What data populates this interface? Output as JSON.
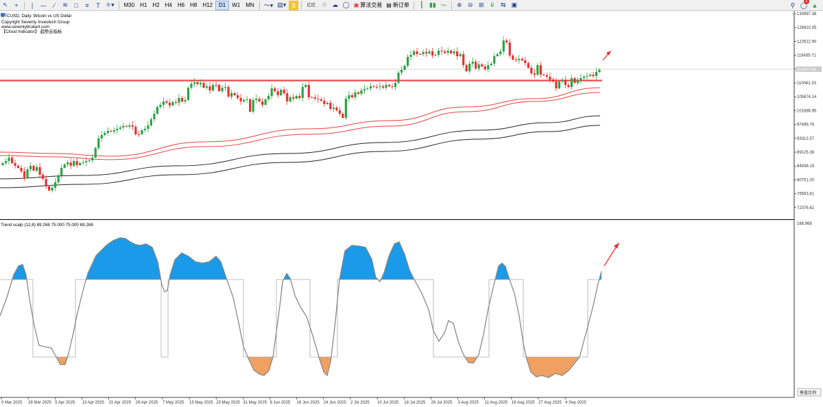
{
  "toolbar": {
    "timeframes": [
      {
        "label": "M30",
        "active": false
      },
      {
        "label": "H1",
        "active": false
      },
      {
        "label": "H2",
        "active": false
      },
      {
        "label": "H4",
        "active": false
      },
      {
        "label": "H6",
        "active": false
      },
      {
        "label": "H8",
        "active": false
      },
      {
        "label": "H12",
        "active": false
      },
      {
        "label": "D1",
        "active": true
      },
      {
        "label": "W1",
        "active": false
      },
      {
        "label": "MN",
        "active": false
      }
    ],
    "algo_trading_label": "算法交易",
    "new_order_label": "新订单",
    "ide_label": "IDE",
    "notifications_count": "1"
  },
  "main_chart": {
    "symbol_line": "BTCUSD, Daily:  Bitcoin vs US Dollar",
    "copyright": "Copyright Seventy Investech Group",
    "website": "www.seventybrokert.com",
    "indicator_name": "【Cloud Indicator】 趋势云指标",
    "price_labels": [
      "130997.38",
      "126810.05",
      "122622.90",
      "118435.71",
      "114248.52",
      "110061.33",
      "105874.14",
      "101686.95",
      "97499.76",
      "93312.57",
      "89125.38",
      "84938.19",
      "80751.00",
      "76563.81",
      "72376.62"
    ],
    "current_price": "113977.50",
    "support_level": "111200",
    "colors": {
      "bull": "#26a643",
      "bear": "#e8302c",
      "support": "#f04848",
      "ema_fast": "#e84040",
      "ema_slow": "#222222",
      "arrow": "#e8302c"
    }
  },
  "sub_chart": {
    "title": "Trend scalp (12,8) 89.268 75.000 75.000 89.268",
    "max_label": "188.968",
    "scale_button": "垂直比例",
    "colors": {
      "upper": "#1a9ae8",
      "lower": "#f0a060",
      "line": "#888888"
    }
  },
  "date_labels": [
    "0 Mar 2025",
    "28 Mar 2025",
    "5 Apr 2025",
    "13 Apr 2025",
    "21 Apr 2025",
    "29 Apr 2025",
    "7 May 2025",
    "15 May 2025",
    "23 May 2025",
    "31 May 2025",
    "8 Jun 2025",
    "16 Jun 2025",
    "24 Jun 2025",
    "2 Jul 2025",
    "10 Jul 2025",
    "18 Jul 2025",
    "26 Jul 2025",
    "3 Aug 2025",
    "11 Aug 2025",
    "19 Aug 2025",
    "27 Aug 2025",
    "4 Sep 2025"
  ]
}
